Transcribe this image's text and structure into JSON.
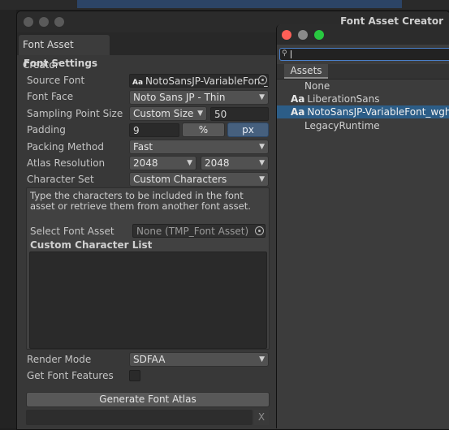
{
  "window": {
    "title": "Font Asset Creator",
    "tab": "Font Asset Creator"
  },
  "font_settings": {
    "section_title": "Font Settings",
    "source_font": {
      "label": "Source Font",
      "value": "NotoSansJP-VariableFont_wght",
      "icon_text": "Aa"
    },
    "font_face": {
      "label": "Font Face",
      "value": "Noto Sans JP - Thin"
    },
    "sampling": {
      "label": "Sampling Point Size",
      "mode": "Custom Size",
      "value": "50"
    },
    "padding": {
      "label": "Padding",
      "value": "9",
      "percent": "%",
      "px": "px"
    },
    "packing": {
      "label": "Packing Method",
      "value": "Fast"
    },
    "atlas": {
      "label": "Atlas Resolution",
      "width": "2048",
      "height": "2048"
    },
    "charset": {
      "label": "Character Set",
      "value": "Custom Characters"
    },
    "help_text": "Type the characters to be included in the font asset or retrieve them from another font asset.",
    "select_font_asset": {
      "label": "Select Font Asset",
      "value": "None (TMP_Font Asset)"
    },
    "custom_char_list_label": "Custom Character List",
    "custom_char_list_value": "",
    "render_mode": {
      "label": "Render Mode",
      "value": "SDFAA"
    },
    "get_font_features": {
      "label": "Get Font Features",
      "checked": false
    },
    "generate_button": "Generate Font Atlas",
    "clear_button": "X"
  },
  "picker": {
    "search_value": "",
    "tab": "Assets",
    "items": [
      {
        "label": "None",
        "icon": "",
        "selected": false
      },
      {
        "label": "LiberationSans",
        "icon": "Aa",
        "selected": false
      },
      {
        "label": "NotoSansJP-VariableFont_wght",
        "icon": "Aa",
        "selected": true
      },
      {
        "label": "LegacyRuntime",
        "icon": "",
        "selected": false
      }
    ],
    "dot_colors": {
      "close": "#ff5f57",
      "minimize": "#8a8a8a",
      "zoom": "#28c840"
    }
  }
}
